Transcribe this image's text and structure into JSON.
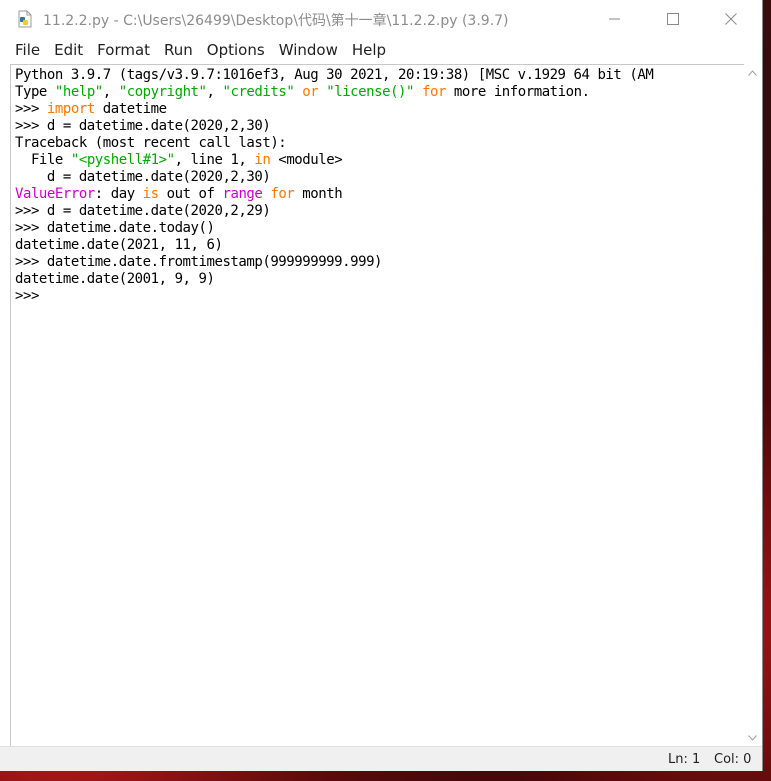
{
  "window": {
    "title": "11.2.2.py - C:\\Users\\26499\\Desktop\\代码\\第十一章\\11.2.2.py (3.9.7)",
    "controls": {
      "minimize_icon": "minimize-icon",
      "maximize_icon": "maximize-icon",
      "close_icon": "close-icon"
    }
  },
  "menu": {
    "items": [
      "File",
      "Edit",
      "Format",
      "Run",
      "Options",
      "Window",
      "Help"
    ]
  },
  "shell": {
    "lines": [
      [
        {
          "t": "Python 3.9.7 (tags/v3.9.7:1016ef3, Aug 30 2021, 20:19:38) [MSC v.1929 64 bit (AM",
          "c": "plain"
        }
      ],
      [
        {
          "t": "Type ",
          "c": "plain"
        },
        {
          "t": "\"help\"",
          "c": "str"
        },
        {
          "t": ", ",
          "c": "plain"
        },
        {
          "t": "\"copyright\"",
          "c": "str"
        },
        {
          "t": ", ",
          "c": "plain"
        },
        {
          "t": "\"credits\"",
          "c": "str"
        },
        {
          "t": " ",
          "c": "plain"
        },
        {
          "t": "or",
          "c": "kw"
        },
        {
          "t": " ",
          "c": "plain"
        },
        {
          "t": "\"license()\"",
          "c": "str"
        },
        {
          "t": " ",
          "c": "plain"
        },
        {
          "t": "for",
          "c": "kw"
        },
        {
          "t": " more information.",
          "c": "plain"
        }
      ],
      [
        {
          "t": ">>> ",
          "c": "plain"
        },
        {
          "t": "import",
          "c": "kw"
        },
        {
          "t": " datetime",
          "c": "plain"
        }
      ],
      [
        {
          "t": ">>> d = datetime.date(2020,2,30)",
          "c": "plain"
        }
      ],
      [
        {
          "t": "Traceback (most recent call last):",
          "c": "plain"
        }
      ],
      [
        {
          "t": "  File ",
          "c": "plain"
        },
        {
          "t": "\"<pyshell#1>\"",
          "c": "str"
        },
        {
          "t": ", line 1, ",
          "c": "plain"
        },
        {
          "t": "in",
          "c": "kw"
        },
        {
          "t": " <module>",
          "c": "plain"
        }
      ],
      [
        {
          "t": "    d = datetime.date(2020,2,30)",
          "c": "plain"
        }
      ],
      [
        {
          "t": "ValueError",
          "c": "err"
        },
        {
          "t": ": day ",
          "c": "plain"
        },
        {
          "t": "is",
          "c": "kw"
        },
        {
          "t": " out of ",
          "c": "plain"
        },
        {
          "t": "range",
          "c": "err"
        },
        {
          "t": " ",
          "c": "plain"
        },
        {
          "t": "for",
          "c": "kw"
        },
        {
          "t": " month",
          "c": "plain"
        }
      ],
      [
        {
          "t": ">>> d = datetime.date(2020,2,29)",
          "c": "plain"
        }
      ],
      [
        {
          "t": ">>> datetime.date.today()",
          "c": "plain"
        }
      ],
      [
        {
          "t": "datetime.date(2021, 11, 6)",
          "c": "plain"
        }
      ],
      [
        {
          "t": ">>> datetime.date.fromtimestamp(999999999.999)",
          "c": "plain"
        }
      ],
      [
        {
          "t": "datetime.date(2001, 9, 9)",
          "c": "plain"
        }
      ],
      [
        {
          "t": ">>> ",
          "c": "plain"
        }
      ]
    ]
  },
  "status": {
    "line": "Ln: 1",
    "column": "Col: 0"
  },
  "colors": {
    "keyword": "#ff7700",
    "string": "#00aa00",
    "error": "#cc00cc",
    "text": "#000000"
  }
}
